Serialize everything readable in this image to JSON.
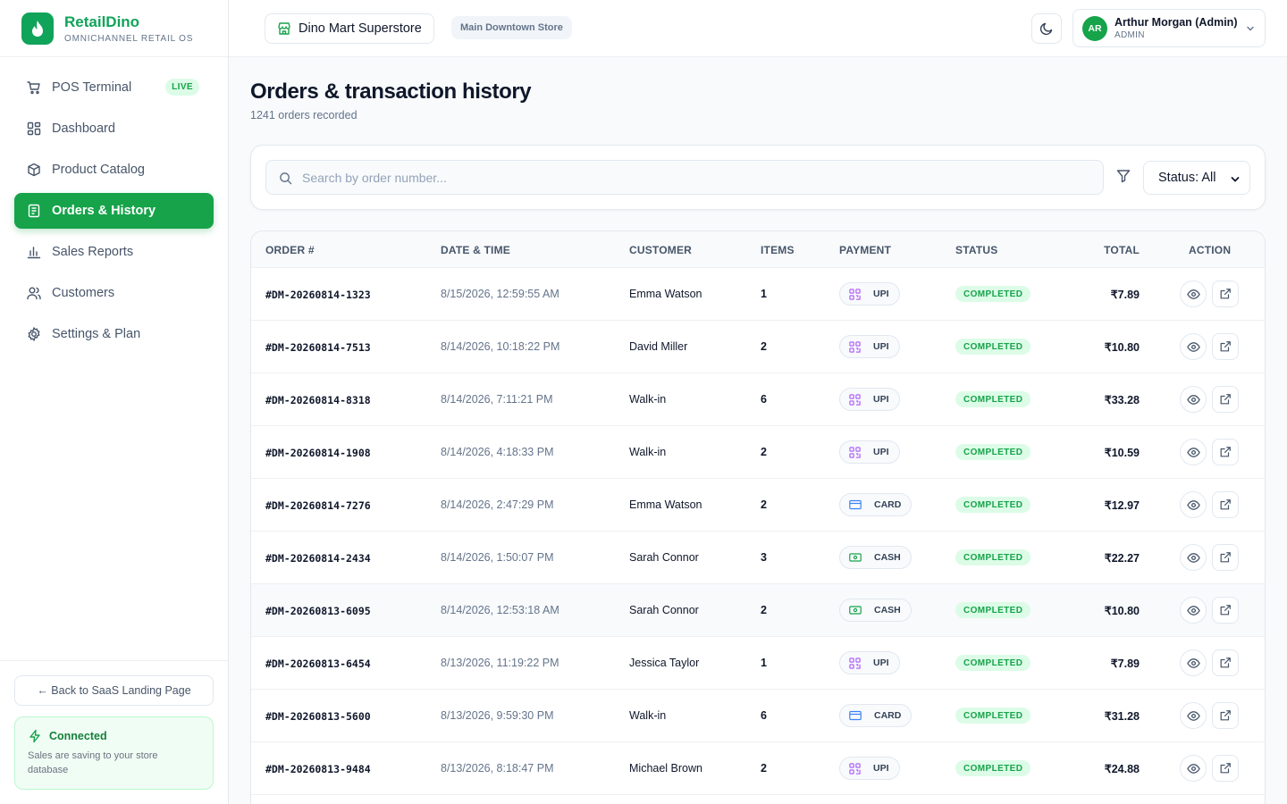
{
  "brand": {
    "name": "RetailDino",
    "subtitle": "OMNICHANNEL RETAIL OS",
    "accent": "#16a34a"
  },
  "sidebar": {
    "items": [
      {
        "label": "POS Terminal",
        "icon": "cart-icon",
        "badge": "LIVE"
      },
      {
        "label": "Dashboard",
        "icon": "grid-icon"
      },
      {
        "label": "Product Catalog",
        "icon": "box-icon"
      },
      {
        "label": "Orders & History",
        "icon": "receipt-icon",
        "active": true
      },
      {
        "label": "Sales Reports",
        "icon": "bar-chart-icon"
      },
      {
        "label": "Customers",
        "icon": "users-icon"
      },
      {
        "label": "Settings & Plan",
        "icon": "gear-icon"
      }
    ],
    "back_label": "← Back to SaaS Landing Page",
    "connection": {
      "title": "Connected",
      "description": "Sales are saving to your store database"
    }
  },
  "header": {
    "store": "Dino Mart Superstore",
    "branch": "Main Downtown Store",
    "user": {
      "initials": "AR",
      "name": "Arthur Morgan (Admin)",
      "role": "ADMIN"
    }
  },
  "page": {
    "title": "Orders & transaction history",
    "subtitle": "1241 orders recorded"
  },
  "filters": {
    "search_placeholder": "Search by order number...",
    "status_label": "Status: All"
  },
  "table": {
    "columns": [
      "ORDER #",
      "DATE & TIME",
      "CUSTOMER",
      "ITEMS",
      "PAYMENT",
      "STATUS",
      "TOTAL",
      "ACTION"
    ],
    "rows": [
      {
        "order": "#DM-20260814-1323",
        "date": "8/15/2026, 12:59:55 AM",
        "customer": "Emma Watson",
        "items": "1",
        "payment": "UPI",
        "status": "COMPLETED",
        "total": "₹7.89"
      },
      {
        "order": "#DM-20260814-7513",
        "date": "8/14/2026, 10:18:22 PM",
        "customer": "David Miller",
        "items": "2",
        "payment": "UPI",
        "status": "COMPLETED",
        "total": "₹10.80"
      },
      {
        "order": "#DM-20260814-8318",
        "date": "8/14/2026, 7:11:21 PM",
        "customer": "Walk-in",
        "items": "6",
        "payment": "UPI",
        "status": "COMPLETED",
        "total": "₹33.28"
      },
      {
        "order": "#DM-20260814-1908",
        "date": "8/14/2026, 4:18:33 PM",
        "customer": "Walk-in",
        "items": "2",
        "payment": "UPI",
        "status": "COMPLETED",
        "total": "₹10.59"
      },
      {
        "order": "#DM-20260814-7276",
        "date": "8/14/2026, 2:47:29 PM",
        "customer": "Emma Watson",
        "items": "2",
        "payment": "CARD",
        "status": "COMPLETED",
        "total": "₹12.97"
      },
      {
        "order": "#DM-20260814-2434",
        "date": "8/14/2026, 1:50:07 PM",
        "customer": "Sarah Connor",
        "items": "3",
        "payment": "CASH",
        "status": "COMPLETED",
        "total": "₹22.27"
      },
      {
        "order": "#DM-20260813-6095",
        "date": "8/14/2026, 12:53:18 AM",
        "customer": "Sarah Connor",
        "items": "2",
        "payment": "CASH",
        "status": "COMPLETED",
        "total": "₹10.80"
      },
      {
        "order": "#DM-20260813-6454",
        "date": "8/13/2026, 11:19:22 PM",
        "customer": "Jessica Taylor",
        "items": "1",
        "payment": "UPI",
        "status": "COMPLETED",
        "total": "₹7.89"
      },
      {
        "order": "#DM-20260813-5600",
        "date": "8/13/2026, 9:59:30 PM",
        "customer": "Walk-in",
        "items": "6",
        "payment": "CARD",
        "status": "COMPLETED",
        "total": "₹31.28"
      },
      {
        "order": "#DM-20260813-9484",
        "date": "8/13/2026, 8:18:47 PM",
        "customer": "Michael Brown",
        "items": "2",
        "payment": "UPI",
        "status": "COMPLETED",
        "total": "₹24.88"
      }
    ]
  }
}
